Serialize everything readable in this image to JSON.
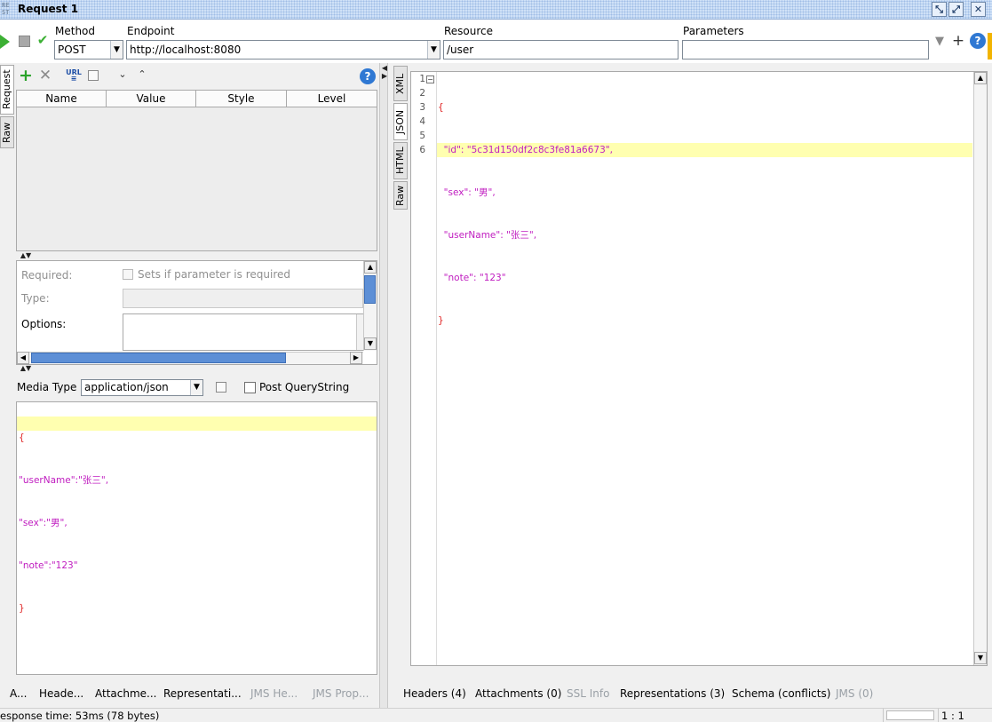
{
  "window": {
    "logo": "RE\nST",
    "title": "Request 1",
    "controls": [
      "restore-icon",
      "maximize-icon",
      "close-icon"
    ]
  },
  "toolbar": {
    "method_label": "Method",
    "method_value": "POST",
    "endpoint_label": "Endpoint",
    "endpoint_value": "http://localhost:8080",
    "resource_label": "Resource",
    "resource_value": "/user",
    "parameters_label": "Parameters",
    "parameters_value": ""
  },
  "request": {
    "vtabs": [
      "Request",
      "Raw"
    ],
    "columns": [
      "Name",
      "Value",
      "Style",
      "Level"
    ],
    "required_label": "Required:",
    "required_checkbox_label": "Sets if parameter is required",
    "type_label": "Type:",
    "options_label": "Options:",
    "media_type_label": "Media Type",
    "media_type_value": "application/json",
    "post_querystring_label": "Post QueryString",
    "body_lines": [
      "{",
      "\"userName\":\"张三\",",
      "\"sex\":\"男\",",
      "\"note\":\"123\"",
      "}"
    ],
    "bottom_tabs": [
      {
        "label": "A...",
        "disabled": false
      },
      {
        "label": "Heade...",
        "disabled": false
      },
      {
        "label": "Attachme...",
        "disabled": false
      },
      {
        "label": "Representati...",
        "disabled": false
      },
      {
        "label": "JMS He...",
        "disabled": true
      },
      {
        "label": "JMS Prop...",
        "disabled": true
      }
    ],
    "status": "esponse time: 53ms (78 bytes)"
  },
  "response": {
    "vtabs": [
      "XML",
      "JSON",
      "HTML",
      "Raw"
    ],
    "line_numbers": [
      "1",
      "2",
      "3",
      "4",
      "5",
      "6"
    ],
    "lines": [
      "{",
      "  \"id\": \"5c31d150df2c8c3fe81a6673\",",
      "  \"sex\": \"男\",",
      "  \"userName\": \"张三\",",
      "  \"note\": \"123\"",
      "}"
    ],
    "bottom_tabs": [
      {
        "label": "Headers (4)",
        "disabled": false
      },
      {
        "label": "Attachments (0)",
        "disabled": false
      },
      {
        "label": "SSL Info",
        "disabled": true
      },
      {
        "label": "Representations (3)",
        "disabled": false
      },
      {
        "label": "Schema (conflicts)",
        "disabled": false
      },
      {
        "label": "JMS (0)",
        "disabled": true
      }
    ],
    "cursor_position": "1 : 1"
  },
  "colors": {
    "highlight_line": "#ffffb0",
    "json_string": "#c01dc0",
    "brace": "#e02222",
    "run_green": "#3cb034"
  }
}
